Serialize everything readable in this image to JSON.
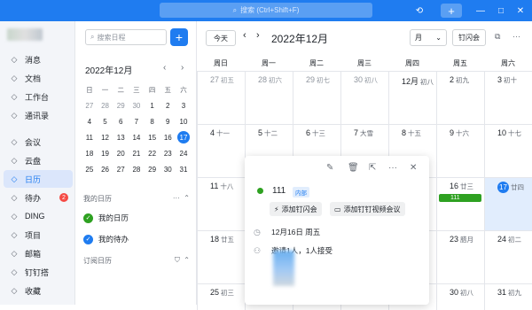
{
  "titlebar": {
    "search_placeholder": "搜索 (Ctrl+Shift+F)",
    "plus": "+",
    "history_icon": "history-icon",
    "minimize": "—",
    "maximize": "□",
    "close": "✕"
  },
  "nav": {
    "items": [
      {
        "label": "消息",
        "icon": "message-icon"
      },
      {
        "label": "文档",
        "icon": "doc-icon"
      },
      {
        "label": "工作台",
        "icon": "workbench-icon"
      },
      {
        "label": "通讯录",
        "icon": "contacts-icon"
      },
      {
        "label": "会议",
        "icon": "meeting-icon"
      },
      {
        "label": "云盘",
        "icon": "cloud-icon"
      },
      {
        "label": "日历",
        "icon": "calendar-icon"
      },
      {
        "label": "待办",
        "icon": "todo-icon",
        "badge": "2"
      },
      {
        "label": "DING",
        "icon": "ding-icon"
      },
      {
        "label": "项目",
        "icon": "project-icon"
      },
      {
        "label": "邮箱",
        "icon": "mail-icon"
      },
      {
        "label": "钉钉搭",
        "icon": "builder-icon"
      },
      {
        "label": "收藏",
        "icon": "favorite-icon"
      }
    ],
    "active_index": 6
  },
  "sidebar": {
    "search_placeholder": "搜索日程",
    "add": "+",
    "mini_title": "2022年12月",
    "prev": "‹",
    "next": "›",
    "weekdays": [
      "日",
      "一",
      "二",
      "三",
      "四",
      "五",
      "六"
    ],
    "days": [
      {
        "d": "27",
        "dim": true
      },
      {
        "d": "28",
        "dim": true
      },
      {
        "d": "29",
        "dim": true
      },
      {
        "d": "30",
        "dim": true
      },
      {
        "d": "1"
      },
      {
        "d": "2"
      },
      {
        "d": "3"
      },
      {
        "d": "4"
      },
      {
        "d": "5"
      },
      {
        "d": "6"
      },
      {
        "d": "7"
      },
      {
        "d": "8"
      },
      {
        "d": "9"
      },
      {
        "d": "10"
      },
      {
        "d": "11"
      },
      {
        "d": "12"
      },
      {
        "d": "13"
      },
      {
        "d": "14"
      },
      {
        "d": "15"
      },
      {
        "d": "16"
      },
      {
        "d": "17",
        "today": true
      },
      {
        "d": "18"
      },
      {
        "d": "19"
      },
      {
        "d": "20"
      },
      {
        "d": "21"
      },
      {
        "d": "22"
      },
      {
        "d": "23"
      },
      {
        "d": "24"
      },
      {
        "d": "25"
      },
      {
        "d": "26"
      },
      {
        "d": "27"
      },
      {
        "d": "28"
      },
      {
        "d": "29"
      },
      {
        "d": "30"
      },
      {
        "d": "31"
      }
    ],
    "my_calendars_label": "我的日历",
    "my_calendars_more": "···",
    "calendars": [
      {
        "label": "我的日历",
        "color": "#2ea121"
      },
      {
        "label": "我的待办",
        "color": "#1f7cf0"
      }
    ],
    "subscribed_label": "订阅日历"
  },
  "toolbar": {
    "today": "今天",
    "prev": "‹",
    "next": "›",
    "month_title": "2022年12月",
    "view": "月",
    "view_arrow": "⌄",
    "flash_meeting": "钉闪会"
  },
  "calendar": {
    "weekdays": [
      "周日",
      "周一",
      "周二",
      "周三",
      "周四",
      "周五",
      "周六"
    ],
    "rows": [
      [
        {
          "d": "27",
          "l": "初五",
          "dim": true
        },
        {
          "d": "28",
          "l": "初六",
          "dim": true
        },
        {
          "d": "29",
          "l": "初七",
          "dim": true
        },
        {
          "d": "30",
          "l": "初八",
          "dim": true
        },
        {
          "d": "12月",
          "l": "初八"
        },
        {
          "d": "2",
          "l": "初九"
        },
        {
          "d": "3",
          "l": "初十"
        }
      ],
      [
        {
          "d": "4",
          "l": "十一"
        },
        {
          "d": "5",
          "l": "十二"
        },
        {
          "d": "6",
          "l": "十三"
        },
        {
          "d": "7",
          "l": "大雪"
        },
        {
          "d": "8",
          "l": "十五"
        },
        {
          "d": "9",
          "l": "十六"
        },
        {
          "d": "10",
          "l": "十七"
        }
      ],
      [
        {
          "d": "11",
          "l": "十八"
        },
        {
          "d": "",
          "l": ""
        },
        {
          "d": "",
          "l": ""
        },
        {
          "d": "",
          "l": ""
        },
        {
          "d": "",
          "l": ""
        },
        {
          "d": "16",
          "l": "廿三",
          "event": "111"
        },
        {
          "d": "17",
          "l": "廿四",
          "today": true
        }
      ],
      [
        {
          "d": "18",
          "l": "廿五"
        },
        {
          "d": "",
          "l": ""
        },
        {
          "d": "",
          "l": ""
        },
        {
          "d": "",
          "l": ""
        },
        {
          "d": "",
          "l": ""
        },
        {
          "d": "23",
          "l": "腊月"
        },
        {
          "d": "24",
          "l": "初二"
        }
      ],
      [
        {
          "d": "25",
          "l": "初三"
        },
        {
          "d": "",
          "l": ""
        },
        {
          "d": "",
          "l": ""
        },
        {
          "d": "",
          "l": ""
        },
        {
          "d": "",
          "l": ""
        },
        {
          "d": "30",
          "l": "初八"
        },
        {
          "d": "31",
          "l": "初九"
        }
      ]
    ]
  },
  "popup": {
    "title": "111",
    "tag": "内部",
    "add_flash": "添加钉闪会",
    "add_video": "添加钉钉视频会议",
    "date": "12月16日 周五",
    "invite": "邀请1人，1人接受"
  }
}
